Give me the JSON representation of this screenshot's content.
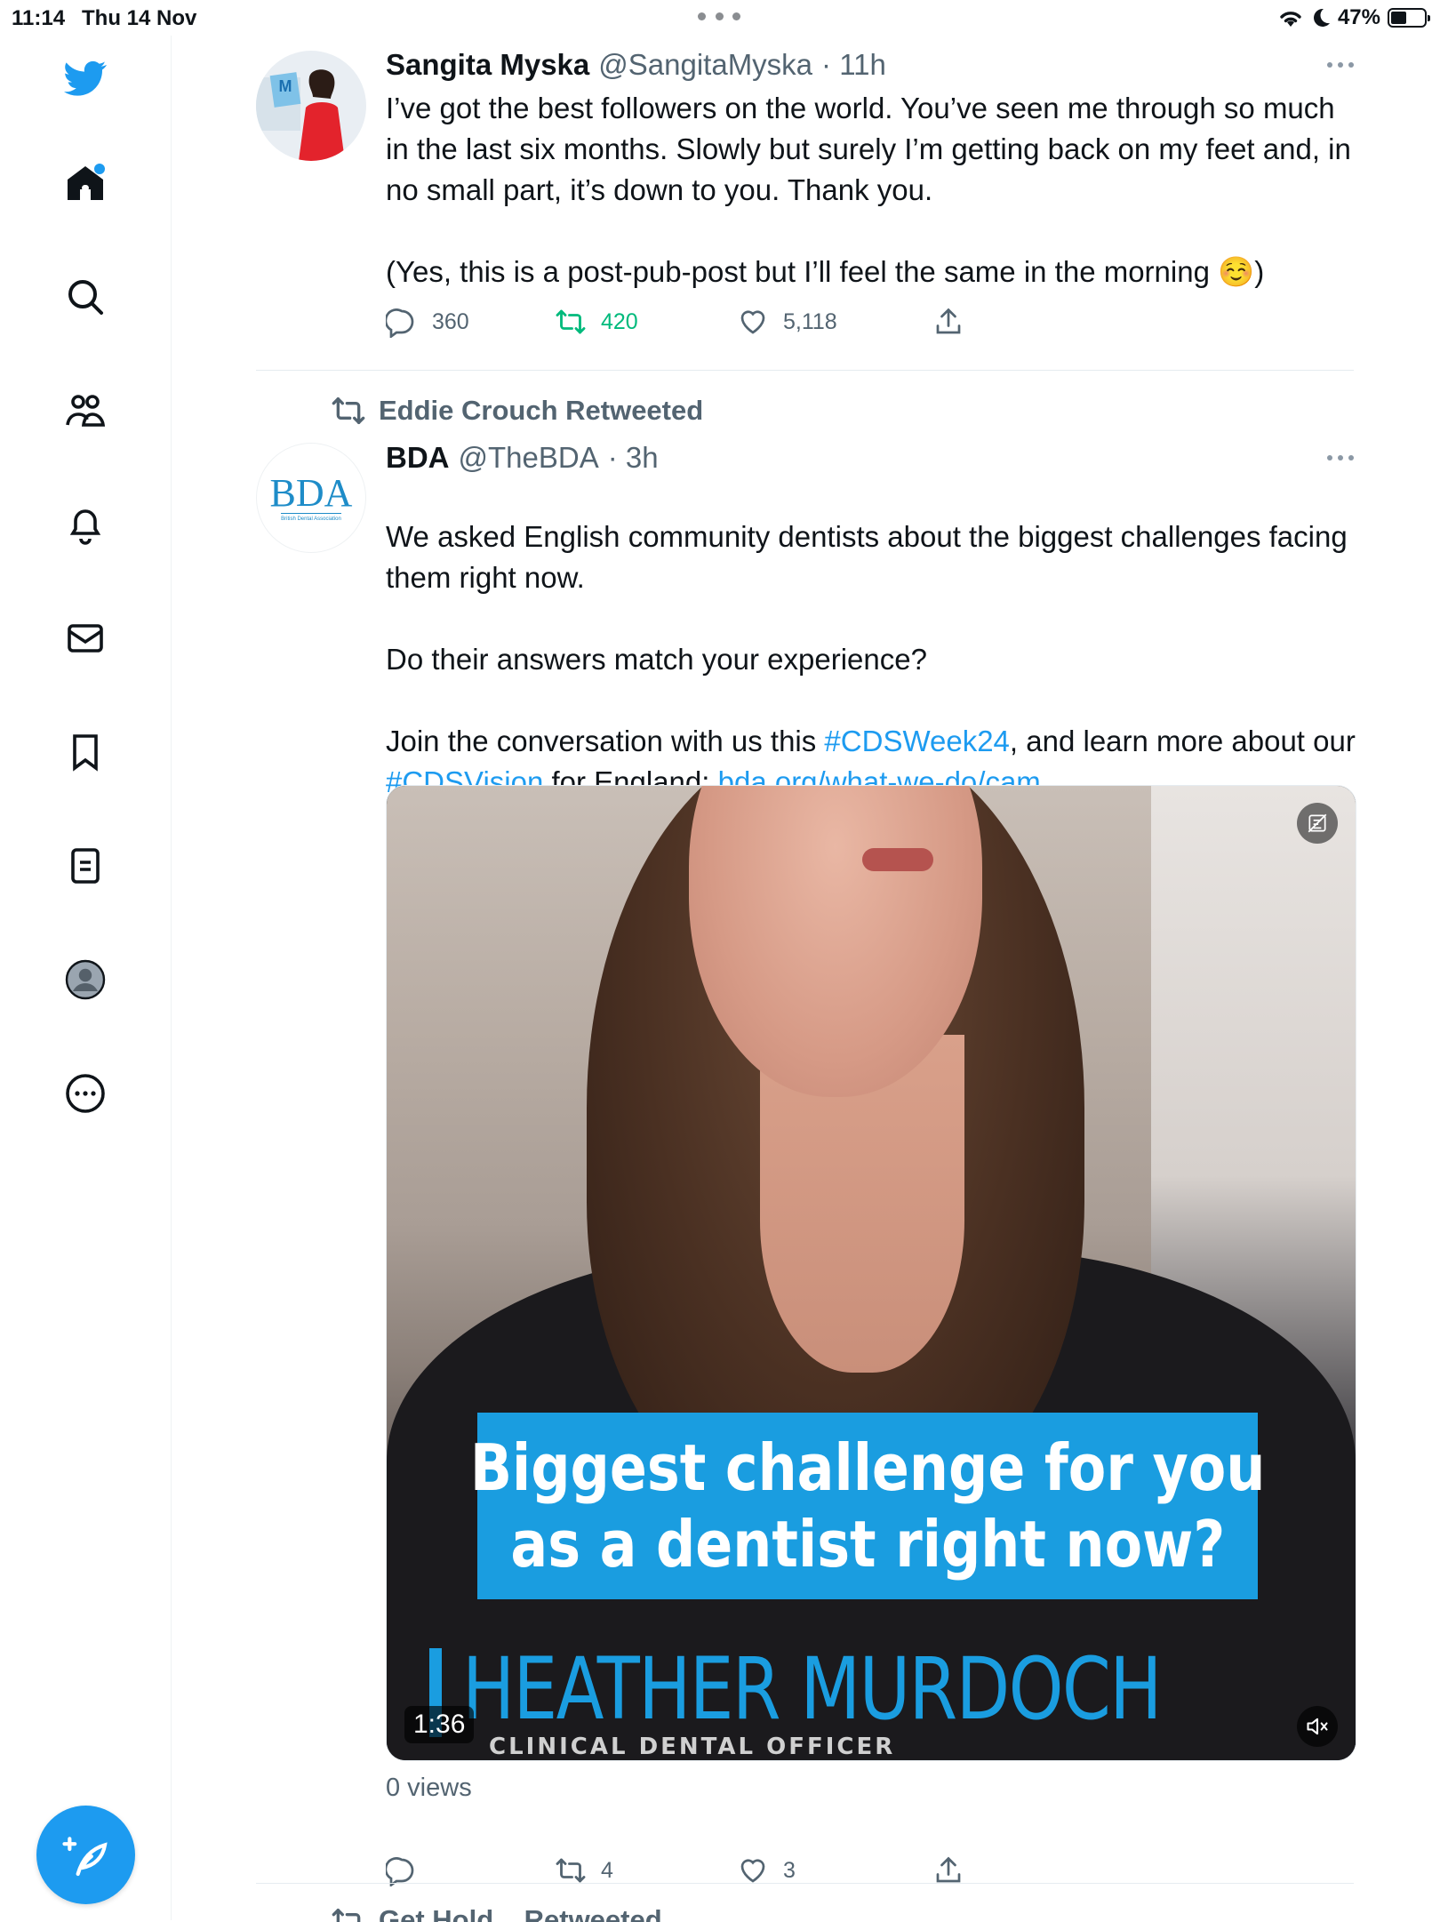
{
  "status_bar": {
    "time": "11:14",
    "date": "Thu 14 Nov",
    "battery": "47%",
    "battery_level": 0.47
  },
  "sidebar": {
    "items": [
      {
        "icon": "twitter-logo-icon"
      },
      {
        "icon": "home-icon",
        "has_notification": true
      },
      {
        "icon": "search-icon"
      },
      {
        "icon": "communities-icon"
      },
      {
        "icon": "notifications-bell-icon"
      },
      {
        "icon": "messages-mail-icon"
      },
      {
        "icon": "bookmarks-icon"
      },
      {
        "icon": "lists-icon"
      },
      {
        "icon": "profile-avatar-icon"
      },
      {
        "icon": "more-options-icon"
      }
    ],
    "compose_icon": "compose-tweet-icon",
    "accent_color": "#1d9bf0"
  },
  "tweets": [
    {
      "name": "Sangita Myska",
      "handle": "@SangitaMyska",
      "time": "· 11h",
      "text_p1": "I’ve got the best followers on the world. You’ve seen me through so much in the last six months. Slowly but surely I’m getting back on my feet and, in no small part, it’s down to you. Thank you.",
      "text_p2": "(Yes, this is a post-pub-post but I’ll feel the same in the morning ☺️)",
      "replies": "360",
      "retweets": "420",
      "likes": "5,118",
      "retweeted_by_me": true
    },
    {
      "retweeted_by": "Eddie Crouch Retweeted",
      "name": "BDA",
      "handle": "@TheBDA",
      "time": "· 3h",
      "avatar_text": "BDA",
      "avatar_subtext": "British Dental Association",
      "text_p1": "We asked English community dentists about the biggest challenges facing them right now.",
      "text_p2": "Do their answers match your experience?",
      "text_p3_a": "Join the conversation with us this ",
      "hashtag1": "#CDSWeek24",
      "text_p3_b": ", and learn more about our ",
      "hashtag2": "#CDSVision",
      "text_p3_c": " for England: ",
      "url": "bda.org/what-we-do/cam…",
      "video": {
        "caption_line1": "Biggest challenge for you",
        "caption_line2": "as a dentist right now?",
        "person_name": "HEATHER MURDOCH",
        "person_role": "CLINICAL DENTAL OFFICER",
        "duration": "1:36"
      },
      "views": "0 views",
      "replies": "",
      "retweets": "4",
      "likes": "3"
    }
  ],
  "next_tweet_partial": "Get Hold... Retweeted"
}
